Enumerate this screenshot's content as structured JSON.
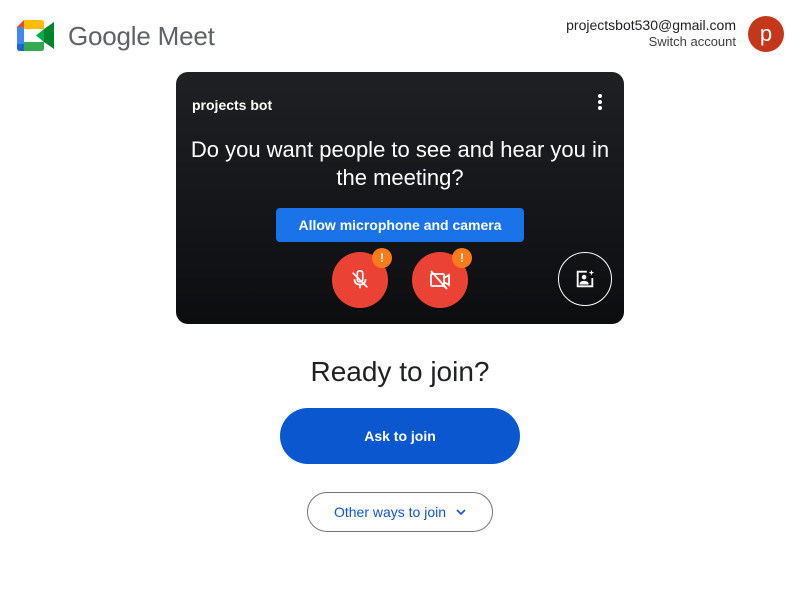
{
  "header": {
    "product_name": "Google Meet",
    "logo_icon": "google-meet-logo",
    "account_email": "projectsbot530@gmail.com",
    "switch_account_label": "Switch account",
    "avatar_letter": "p",
    "avatar_color": "#c5371b"
  },
  "preview": {
    "user_name": "projects bot",
    "question": "Do you want people to see and hear you in the meeting?",
    "allow_button_label": "Allow microphone and camera",
    "mic_warning": "!",
    "camera_warning": "!",
    "icons": {
      "more": "more-vert-icon",
      "mic": "mic-off-icon",
      "camera": "videocam-off-icon",
      "effects": "visual-effects-icon"
    }
  },
  "join": {
    "title": "Ready to join?",
    "ask_button_label": "Ask to join",
    "other_ways_label": "Other ways to join"
  },
  "colors": {
    "primary": "#0b57d0",
    "allow_blue": "#1a73e8",
    "control_red": "#ea4335",
    "warning_orange": "#fa7b17"
  }
}
